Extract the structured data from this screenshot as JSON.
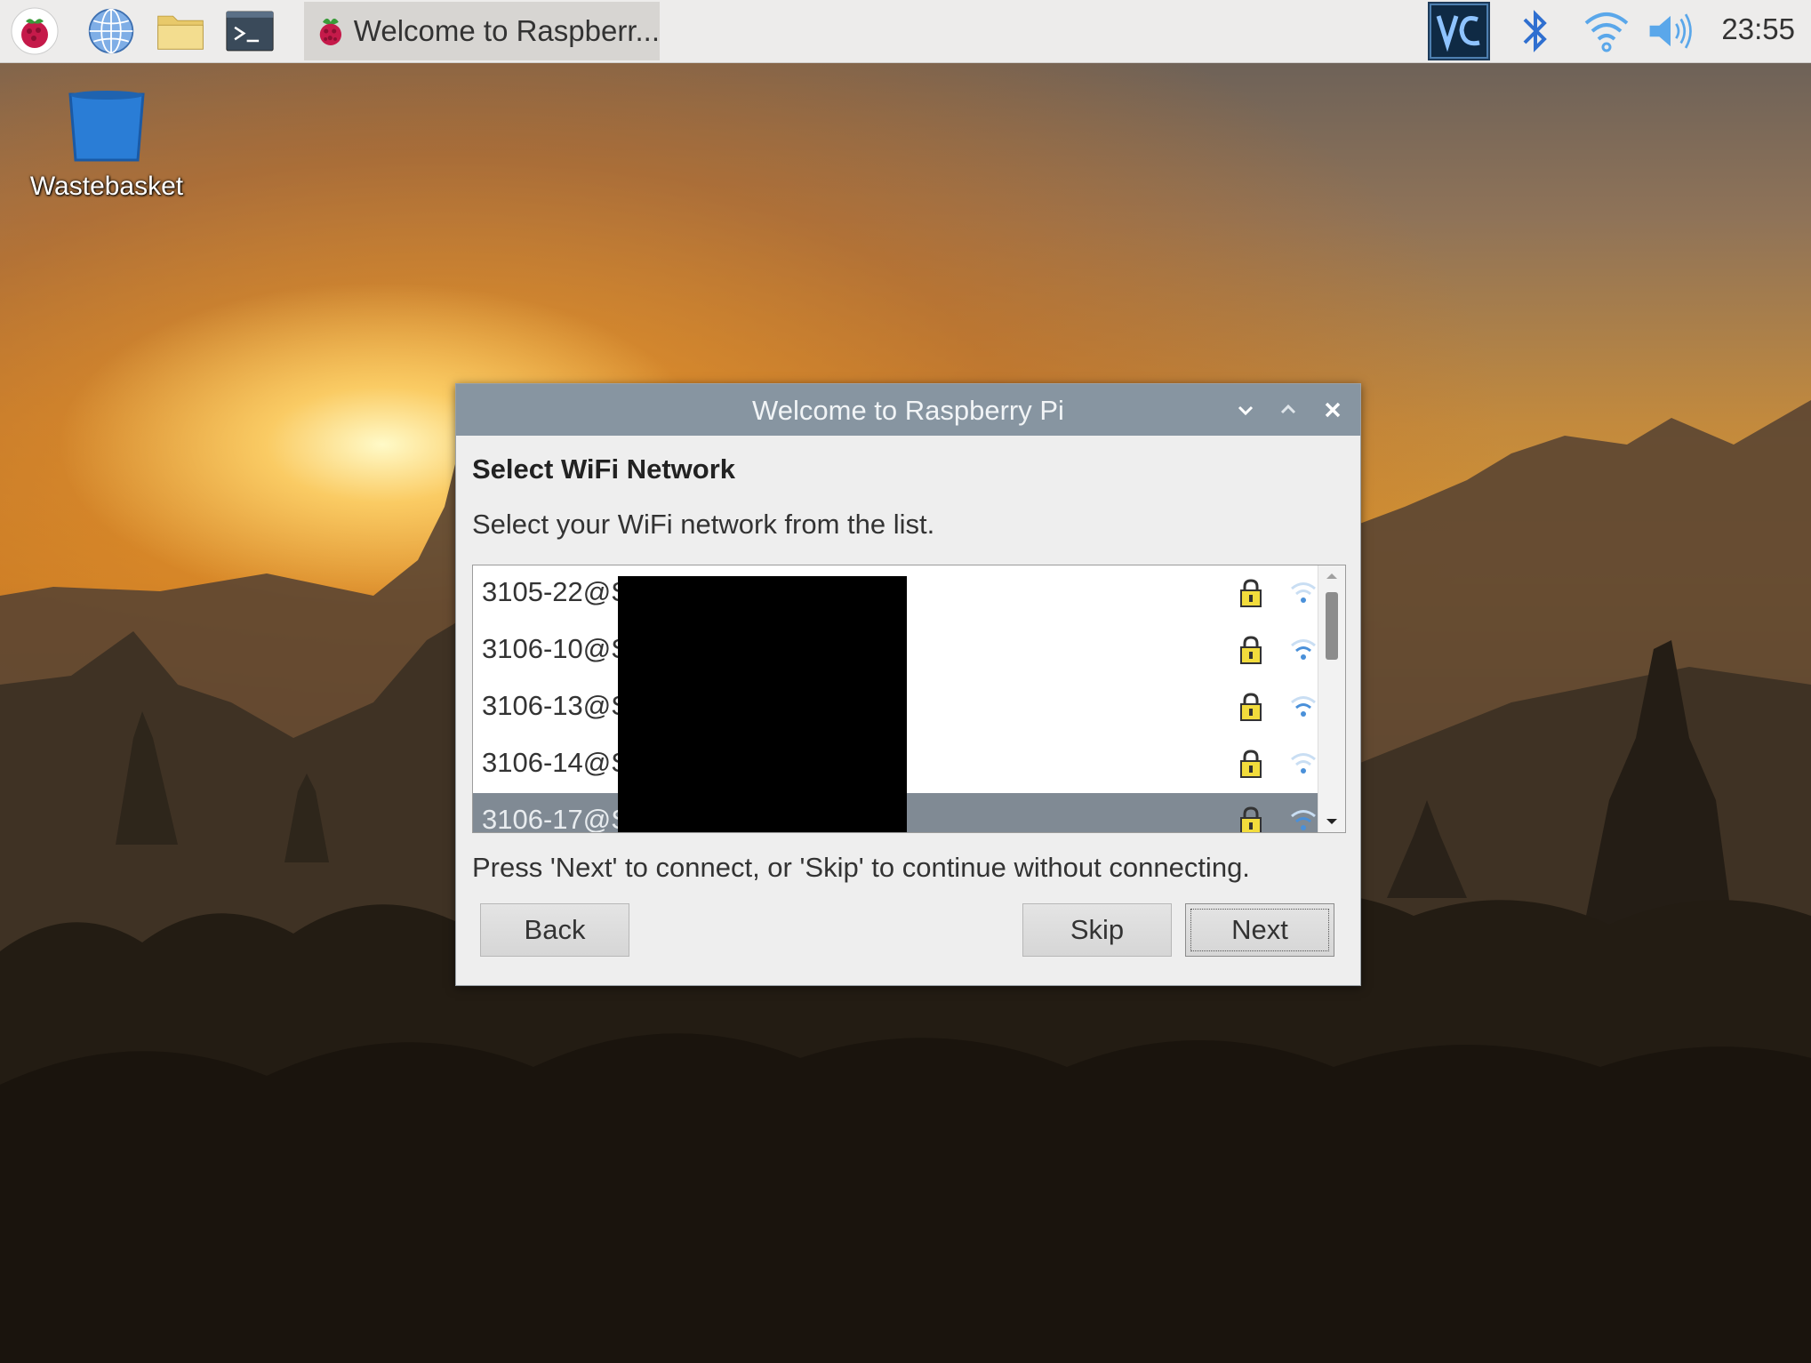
{
  "taskbar": {
    "menu_icon": "raspberry-icon",
    "browser_icon": "globe-icon",
    "files_icon": "folder-icon",
    "terminal_icon": "terminal-icon",
    "active_task_label": "Welcome to Raspberr...",
    "tray": {
      "vnc_icon": "vnc-icon",
      "bluetooth_icon": "bluetooth-icon",
      "wifi_icon": "wifi-icon",
      "volume_icon": "volume-icon",
      "time": "23:55"
    }
  },
  "desktop": {
    "icons": [
      {
        "label": "Wastebasket",
        "icon": "trash-icon"
      }
    ]
  },
  "dialog": {
    "title": "Welcome to Raspberry Pi",
    "heading": "Select WiFi Network",
    "instruction": "Select your WiFi network from the list.",
    "networks": [
      {
        "ssid": "3105-22@S",
        "secured": true,
        "signal": "weak",
        "selected": false
      },
      {
        "ssid": "3106-10@S",
        "secured": true,
        "signal": "medium",
        "selected": false
      },
      {
        "ssid": "3106-13@S",
        "secured": true,
        "signal": "medium",
        "selected": false
      },
      {
        "ssid": "3106-14@S",
        "secured": true,
        "signal": "weak",
        "selected": false
      },
      {
        "ssid": "3106-17@S",
        "secured": true,
        "signal": "medium",
        "selected": true
      }
    ],
    "hint": "Press 'Next' to connect, or 'Skip' to continue without connecting.",
    "buttons": {
      "back": "Back",
      "skip": "Skip",
      "next": "Next"
    }
  },
  "colors": {
    "titlebar": "#8795a1",
    "selection": "#808a94",
    "taskbar": "#edeceb",
    "wifi_blue": "#4a90d9"
  }
}
